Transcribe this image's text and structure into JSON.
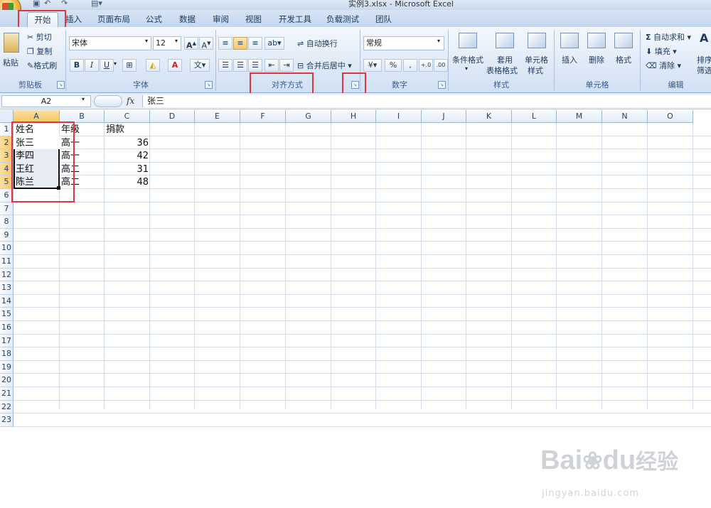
{
  "window": {
    "title": "实例3.xlsx - Microsoft Excel"
  },
  "tabs": [
    "开始",
    "插入",
    "页面布局",
    "公式",
    "数据",
    "审阅",
    "视图",
    "开发工具",
    "负载测试",
    "团队"
  ],
  "ribbon": {
    "clipboard": {
      "paste": "粘贴",
      "cut": "剪切",
      "copy": "复制",
      "format_painter": "格式刷",
      "label": "剪贴板"
    },
    "font": {
      "name": "宋体",
      "size": "12",
      "bold": "B",
      "italic": "I",
      "underline": "U",
      "label": "字体",
      "phonetic": "wén"
    },
    "alignment": {
      "wrap_text": "自动换行",
      "merge_center": "合并后居中",
      "label": "对齐方式"
    },
    "number": {
      "format": "常规",
      "percent": "%",
      "comma": ",",
      "label": "数字"
    },
    "styles": {
      "conditional": "条件格式",
      "table_line1": "套用",
      "table_line2": "表格格式",
      "cell_styles_line1": "单元格",
      "cell_styles_line2": "样式",
      "label": "样式"
    },
    "cells": {
      "insert": "插入",
      "delete": "删除",
      "format": "格式",
      "label": "单元格"
    },
    "editing": {
      "autosum": "自动求和",
      "fill": "填充",
      "clear": "清除",
      "sort": "排序",
      "filter": "筛选",
      "label": "编辑"
    }
  },
  "formula_bar": {
    "name_box": "A2",
    "fx": "fx",
    "content": "张三"
  },
  "columns": [
    "A",
    "B",
    "C",
    "D",
    "E",
    "F",
    "G",
    "H",
    "I",
    "J",
    "K",
    "L",
    "M",
    "N",
    "O"
  ],
  "rows": [
    "1",
    "2",
    "3",
    "4",
    "5",
    "6",
    "7",
    "8",
    "9",
    "10",
    "11",
    "12",
    "13",
    "14",
    "15",
    "16",
    "17",
    "18",
    "19",
    "20",
    "21",
    "22",
    "23"
  ],
  "sheet": {
    "headers": [
      "姓名",
      "年级",
      "捐款"
    ],
    "data": [
      [
        "张三",
        "高一",
        "36"
      ],
      [
        "李四",
        "高一",
        "42"
      ],
      [
        "王红",
        "高二",
        "31"
      ],
      [
        "陈兰",
        "高二",
        "48"
      ]
    ]
  },
  "watermark": {
    "brand": "Bai",
    "brand2": "du",
    "site_cn": "经验",
    "url": "jingyan.baidu.com"
  }
}
